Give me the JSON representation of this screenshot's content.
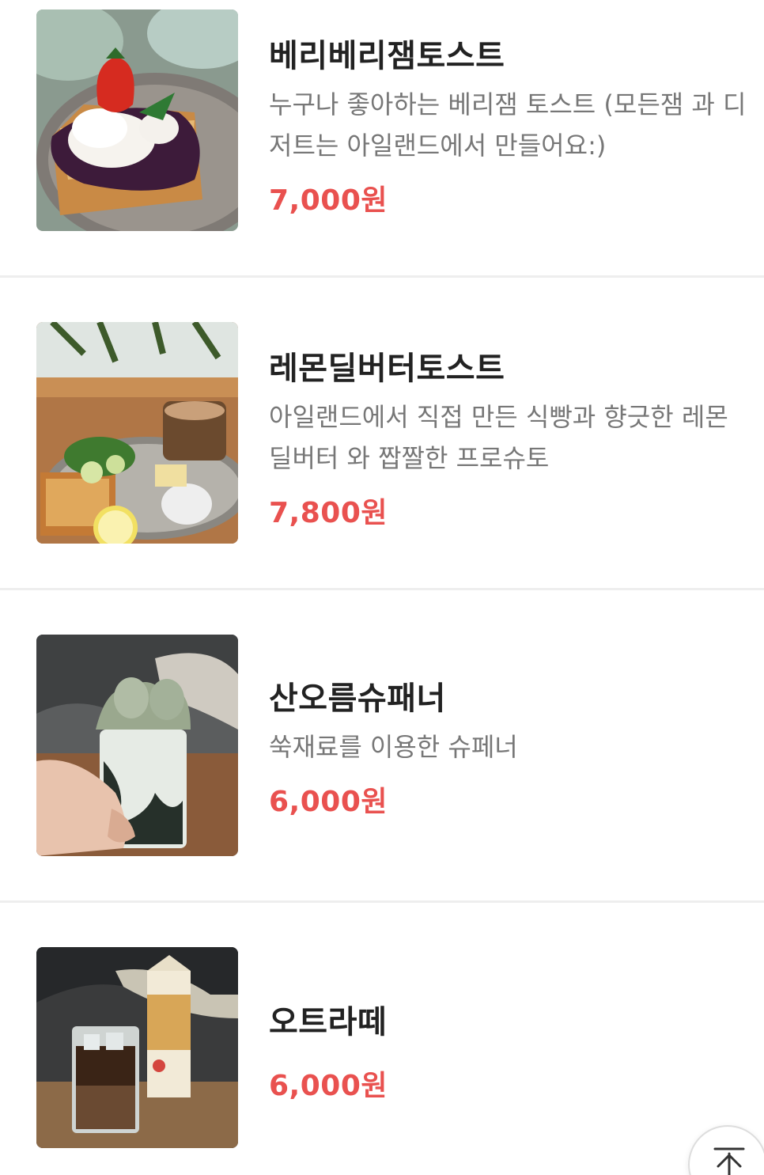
{
  "menu": {
    "items": [
      {
        "name": "베리베리잼토스트",
        "description": "누구나 좋아하는 베리잼 토스트 (모든잼 과 디저트는 아일랜드에서 만들어요:)",
        "price": "7,000원",
        "image": "berry-jam-toast-photo"
      },
      {
        "name": "레몬딜버터토스트",
        "description": "아일랜드에서 직접 만든 식빵과 향긋한 레몬딜버터 와 짭짤한 프로슈토",
        "price": "7,800원",
        "image": "lemon-dill-butter-toast-photo"
      },
      {
        "name": "산오름슈패너",
        "description": "쑥재료를 이용한 슈페너",
        "price": "6,000원",
        "image": "mugwort-einspanner-photo"
      },
      {
        "name": "오트라떼",
        "description": "",
        "price": "6,000원",
        "image": "oat-latte-photo"
      }
    ]
  },
  "top_button": {
    "icon": "arrow-up-to-top-icon"
  },
  "colors": {
    "price": "#e9514f",
    "title": "#222222",
    "description": "#777777",
    "divider": "#eeeeee"
  }
}
